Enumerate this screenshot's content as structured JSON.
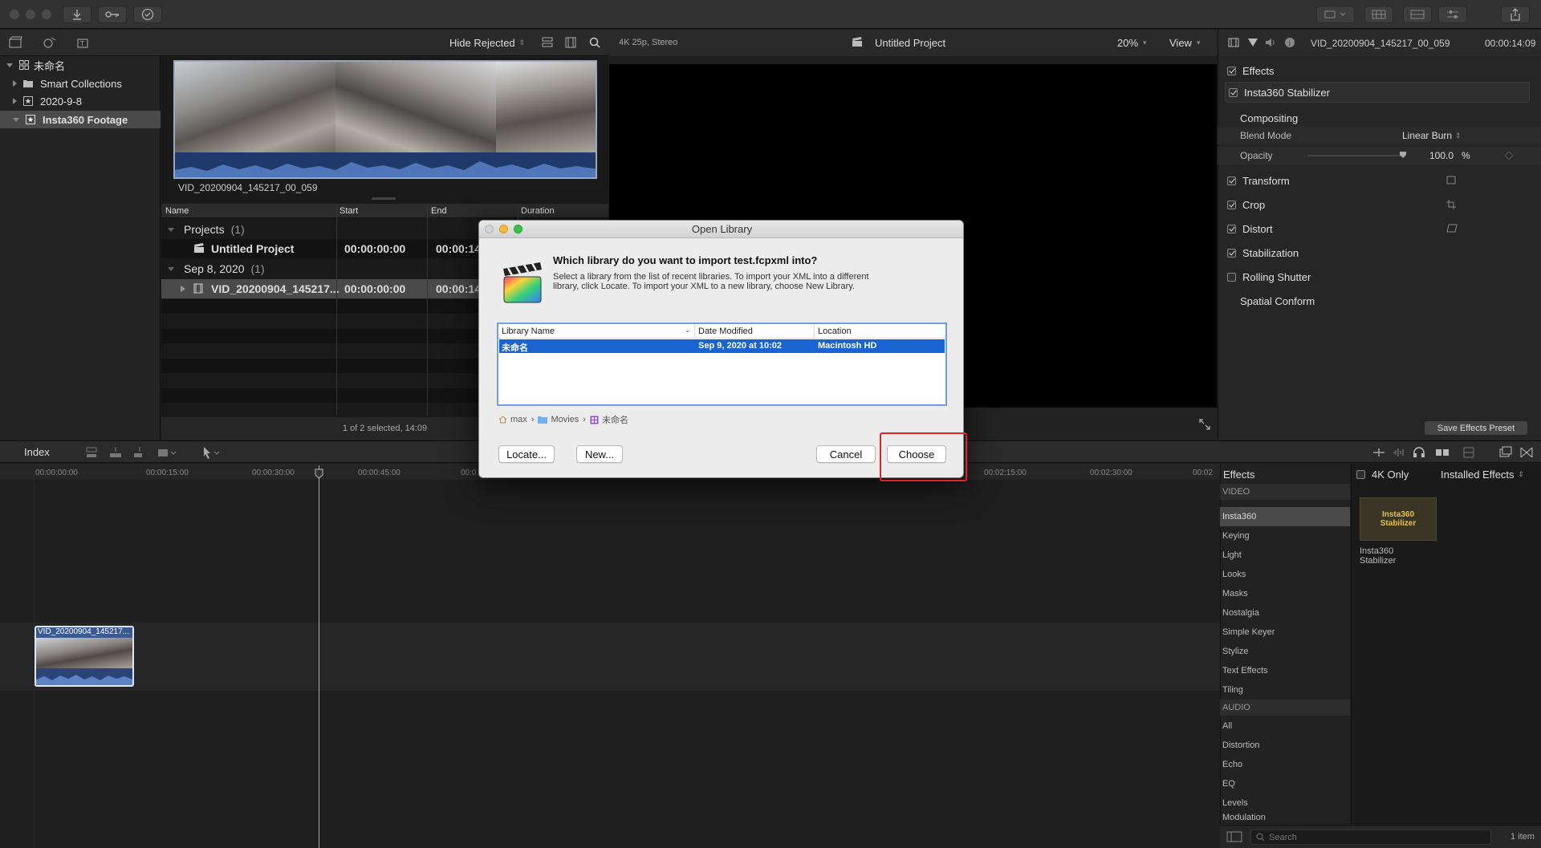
{
  "toolbar": {},
  "library_header": {
    "filter_label": "Hide Rejected"
  },
  "sidebar": {
    "items": [
      {
        "label": "未命名"
      },
      {
        "label": "Smart Collections"
      },
      {
        "label": "2020-9-8"
      },
      {
        "label": "Insta360 Footage"
      }
    ]
  },
  "browser": {
    "clip_name": "VID_20200904_145217_00_059",
    "columns": [
      "Name",
      "Start",
      "End",
      "Duration"
    ],
    "rows": [
      {
        "name": "Projects",
        "count": "(1)"
      },
      {
        "name": "Untitled Project",
        "start": "00:00:00:00",
        "end": "00:00:14"
      },
      {
        "name": "Sep 8, 2020",
        "count": "(1)"
      },
      {
        "name": "VID_20200904_145217...",
        "start": "00:00:00:00",
        "end": "00:00:14"
      }
    ],
    "status": "1 of 2 selected, 14:09"
  },
  "viewer": {
    "format": "4K 25p, Stereo",
    "title": "Untitled Project",
    "zoom": "20%",
    "view_label": "View"
  },
  "inspector": {
    "clip_name": "VID_20200904_145217_00_059",
    "timecode": "00:00:14:09",
    "rows": {
      "effects": "Effects",
      "stabilizer": "Insta360 Stabilizer",
      "compositing": "Compositing",
      "blend_mode_label": "Blend Mode",
      "blend_mode_value": "Linear Burn",
      "opacity_label": "Opacity",
      "opacity_value": "100.0",
      "opacity_unit": "%",
      "transform": "Transform",
      "crop": "Crop",
      "distort": "Distort",
      "stabilization": "Stabilization",
      "rolling_shutter": "Rolling Shutter",
      "spatial_conform": "Spatial Conform"
    },
    "save_preset": "Save Effects Preset"
  },
  "timeline": {
    "index_label": "Index",
    "ruler": [
      "00:00:00:00",
      "00:00:15:00",
      "00:00:30:00",
      "00:00:45:00",
      "00:0",
      "00:02:15:00",
      "00:02:30:00",
      "00:02"
    ],
    "clip_label": "VID_20200904_145217..."
  },
  "effects": {
    "header": "Effects",
    "video_section": "VIDEO",
    "video": [
      "Insta360",
      "Keying",
      "Light",
      "Looks",
      "Masks",
      "Nostalgia",
      "Simple Keyer",
      "Stylize",
      "Text Effects",
      "Tiling"
    ],
    "audio_section": "AUDIO",
    "audio": [
      "All",
      "Distortion",
      "Echo",
      "EQ",
      "Levels",
      "Modulation"
    ],
    "filter_4k": "4K Only",
    "installed": "Installed Effects",
    "tile_label": "Insta360 Stabilizer",
    "tile_line1": "Insta360",
    "tile_line2": "Stabilizer",
    "search_placeholder": "Search",
    "count": "1 item"
  },
  "dialog": {
    "title": "Open Library",
    "question": "Which library do you want to import test.fcpxml into?",
    "body": "Select a library from the list of recent libraries. To import your XML into a different library, click Locate. To import your XML to a new library, choose New Library.",
    "columns": [
      "Library Name",
      "Date Modified",
      "Location"
    ],
    "selected_row": {
      "name": "未命名",
      "date": "Sep 9, 2020 at 10:02",
      "location": "Macintosh HD"
    },
    "path": [
      "max",
      "Movies",
      "未命名"
    ],
    "buttons": {
      "locate": "Locate...",
      "new": "New...",
      "cancel": "Cancel",
      "choose": "Choose"
    },
    "highlight_color": "#e0242b"
  }
}
